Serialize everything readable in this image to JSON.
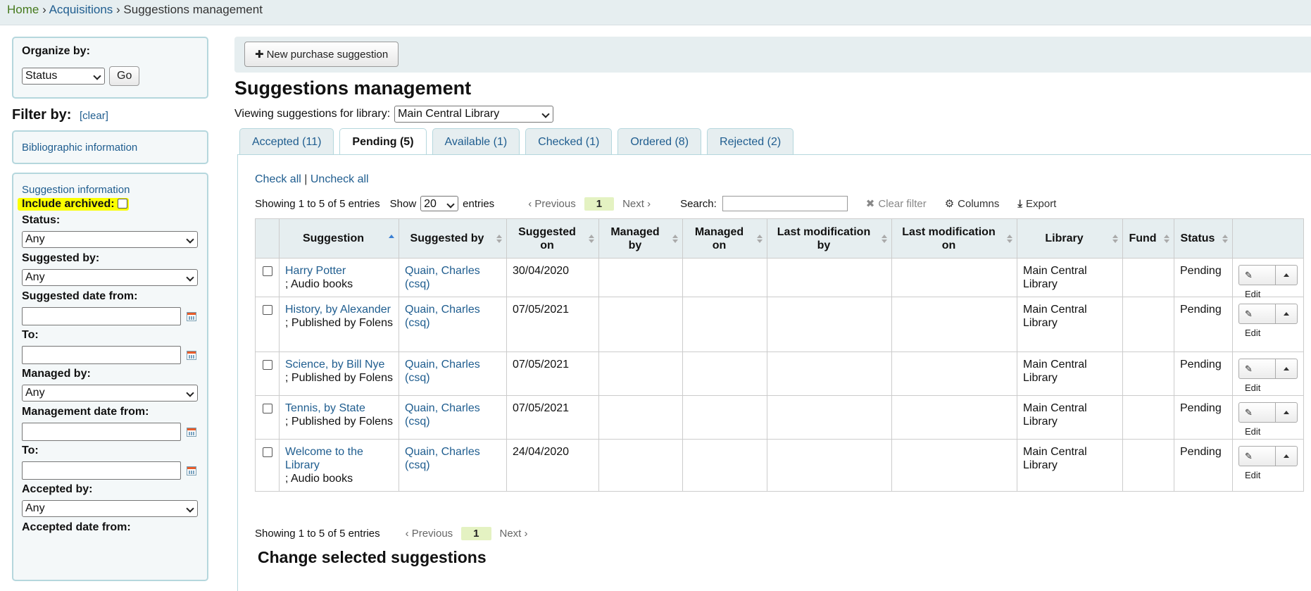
{
  "breadcrumb": {
    "home": "Home",
    "sep1": "›",
    "acquisitions": "Acquisitions",
    "sep2": "›",
    "current": "Suggestions management"
  },
  "sidebar": {
    "organize_label": "Organize by:",
    "organize_value": "Status",
    "go_label": "Go",
    "filter_label": "Filter by:",
    "clear_label": "[clear]",
    "bib_info": "Bibliographic information",
    "sugg_info": "Suggestion information",
    "include_archived": "Include archived:",
    "status_label": "Status:",
    "status_value": "Any",
    "suggested_by_label": "Suggested by:",
    "suggested_by_value": "Any",
    "suggested_date_from": "Suggested date from:",
    "to1": "To:",
    "managed_by_label": "Managed by:",
    "managed_by_value": "Any",
    "management_date_from": "Management date from:",
    "to2": "To:",
    "accepted_by_label": "Accepted by:",
    "accepted_by_value": "Any",
    "accepted_date_from": "Accepted date from:"
  },
  "toolbar": {
    "new_suggestion": "New purchase suggestion"
  },
  "main": {
    "title": "Suggestions management",
    "viewing_label": "Viewing suggestions for library:",
    "library_value": "Main Central Library",
    "tabs": [
      {
        "label": "Accepted (11)"
      },
      {
        "label": "Pending (5)"
      },
      {
        "label": "Available (1)"
      },
      {
        "label": "Checked (1)"
      },
      {
        "label": "Ordered (8)"
      },
      {
        "label": "Rejected (2)"
      }
    ],
    "check_all": "Check all",
    "pipe": "|",
    "uncheck_all": "Uncheck all",
    "showing": "Showing 1 to 5 of 5 entries",
    "show_label": "Show",
    "show_value": "20",
    "entries_label": "entries",
    "previous": "Previous",
    "page": "1",
    "next": "Next",
    "search_label": "Search:",
    "clear_filter": "Clear filter",
    "columns": "Columns",
    "export": "Export",
    "change_selected": "Change selected suggestions"
  },
  "table": {
    "headers": [
      "Suggestion",
      "Suggested by",
      "Suggested on",
      "Managed by",
      "Managed on",
      "Last modification by",
      "Last modification on",
      "Library",
      "Fund",
      "Status"
    ],
    "edit_label": "Edit",
    "rows": [
      {
        "title": "Harry Potter",
        "detail": "; Audio books",
        "by": "Quain, Charles (csq)",
        "on": "30/04/2020",
        "library": "Main Central Library",
        "status": "Pending"
      },
      {
        "title": "History, by Alexander",
        "detail": "; Published by Folens",
        "by": "Quain, Charles (csq)",
        "on": "07/05/2021",
        "library": "Main Central Library",
        "status": "Pending"
      },
      {
        "title": "Science, by Bill Nye",
        "detail": "; Published by Folens",
        "by": "Quain, Charles (csq)",
        "on": "07/05/2021",
        "library": "Main Central Library",
        "status": "Pending"
      },
      {
        "title": "Tennis, by State",
        "detail": "; Published by Folens",
        "by": "Quain, Charles (csq)",
        "on": "07/05/2021",
        "library": "Main Central Library",
        "status": "Pending"
      },
      {
        "title": "Welcome to the Library",
        "detail": "; Audio books",
        "by": "Quain, Charles (csq)",
        "on": "24/04/2020",
        "library": "Main Central Library",
        "status": "Pending"
      }
    ]
  }
}
